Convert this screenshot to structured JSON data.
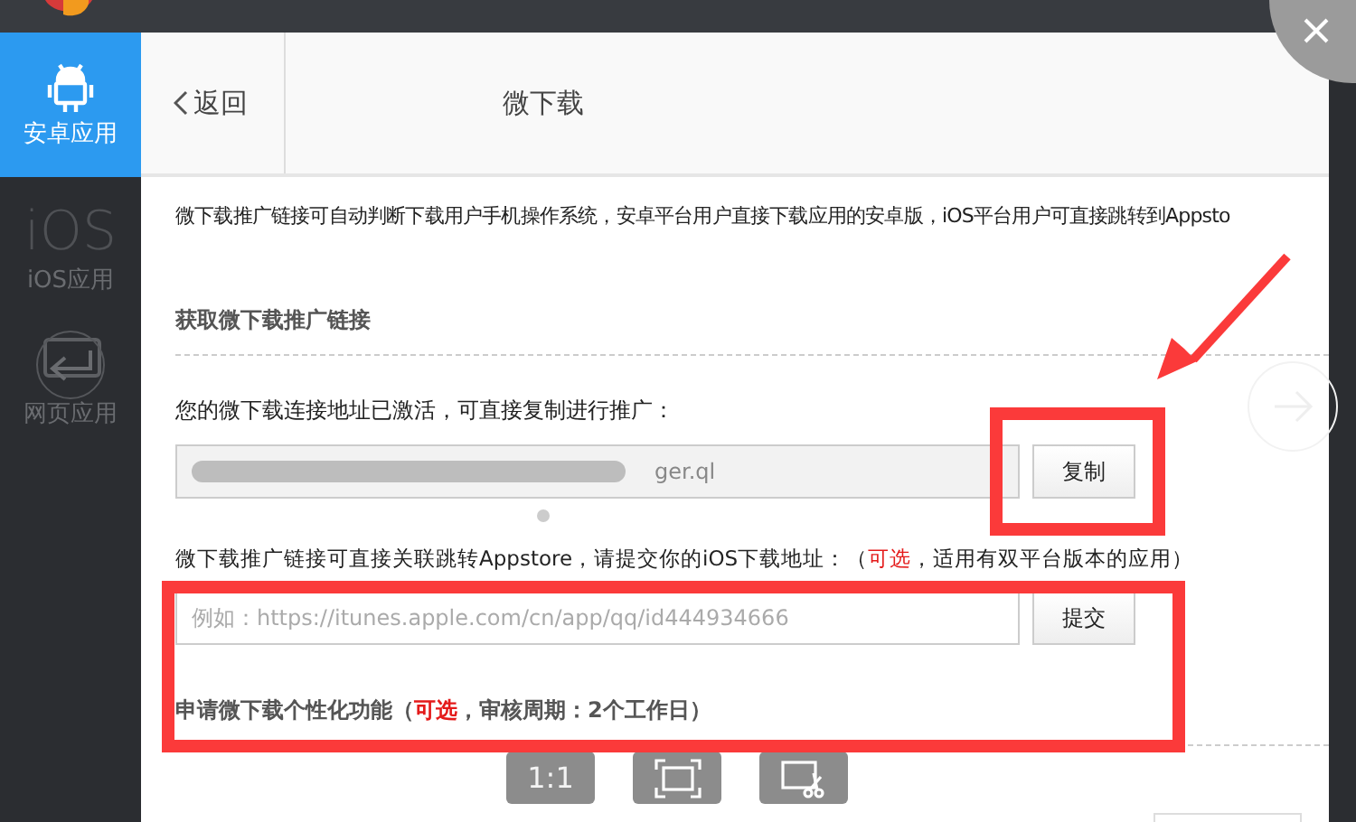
{
  "sidebar": {
    "items": [
      {
        "kind": "android",
        "label": "安卓应用",
        "selected": true
      },
      {
        "kind": "ios",
        "glyph": "iOS",
        "label": "iOS应用",
        "selected": false
      },
      {
        "kind": "web",
        "label": "网页应用",
        "selected": false
      }
    ]
  },
  "header": {
    "back": "返回",
    "title": "微下载"
  },
  "intro": "微下载推广链接可自动判断下载用户手机操作系统，安卓平台用户直接下载应用的安卓版，iOS平台用户可直接跳转到Appsto",
  "link_section": {
    "heading": "获取微下载推广链接",
    "note": "您的微下载连接地址已激活，可直接复制进行推广：",
    "url_field": {
      "value": "ger.ql"
    },
    "copy_button": "复制"
  },
  "ios_section": {
    "hint": "微下载推广链接可直接关联跳转Appstore，请提交你的iOS下载地址：（",
    "optional": "可选",
    "hint_end": "，适用有双平台版本的应用）",
    "field": {
      "placeholder": "例如：https://itunes.apple.com/cn/app/qq/id444934666"
    },
    "submit_button": "提交"
  },
  "custom_section": {
    "heading": "申请微下载个性化功能（",
    "optional": "可选",
    "heading_end": "，审核周期：2个工作日）"
  },
  "viewer_toolbar": [
    {
      "kind": "actual",
      "label": "1:1"
    },
    {
      "kind": "fit"
    },
    {
      "kind": "capture"
    }
  ]
}
